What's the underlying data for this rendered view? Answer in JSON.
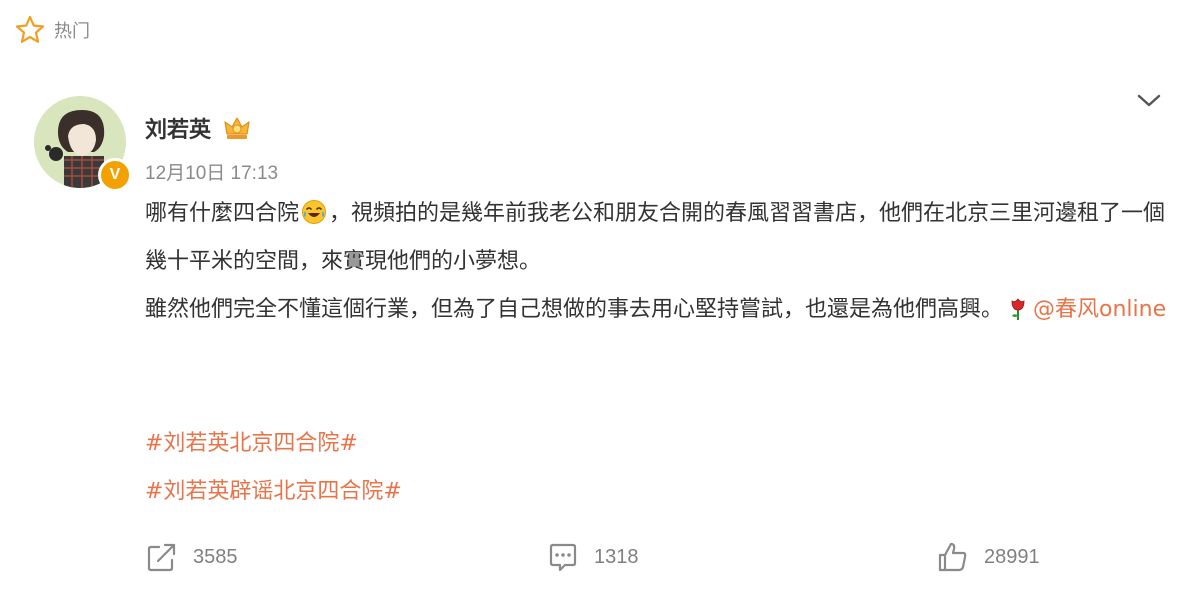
{
  "section": {
    "label": "热门",
    "icon": "star-icon"
  },
  "post": {
    "author": "刘若英",
    "verified_badge": "V",
    "timestamp": "12月10日 17:13",
    "text": {
      "line1_before_emoji": "哪有什麼四合院",
      "line1_after_emoji": "，視頻拍的是幾年前我老公和朋友合開的春風習習書店，他們在北京三里河邊租了一個幾十平米的空間，來實現他們的小夢想。",
      "line2": "雖然他們完全不懂這個行業，但為了自己想做的事去用心堅持嘗試，也還是為他們高興。",
      "mention": "@春风online"
    },
    "topics": [
      "#刘若英北京四合院#",
      "#刘若英辟谣北京四合院#"
    ]
  },
  "actions": {
    "repost_count": "3585",
    "comment_count": "1318",
    "like_count": "28991"
  },
  "colors": {
    "accent": "#e8744a",
    "muted": "#8a8a8a",
    "text": "#333333",
    "badge": "#f2a100"
  }
}
